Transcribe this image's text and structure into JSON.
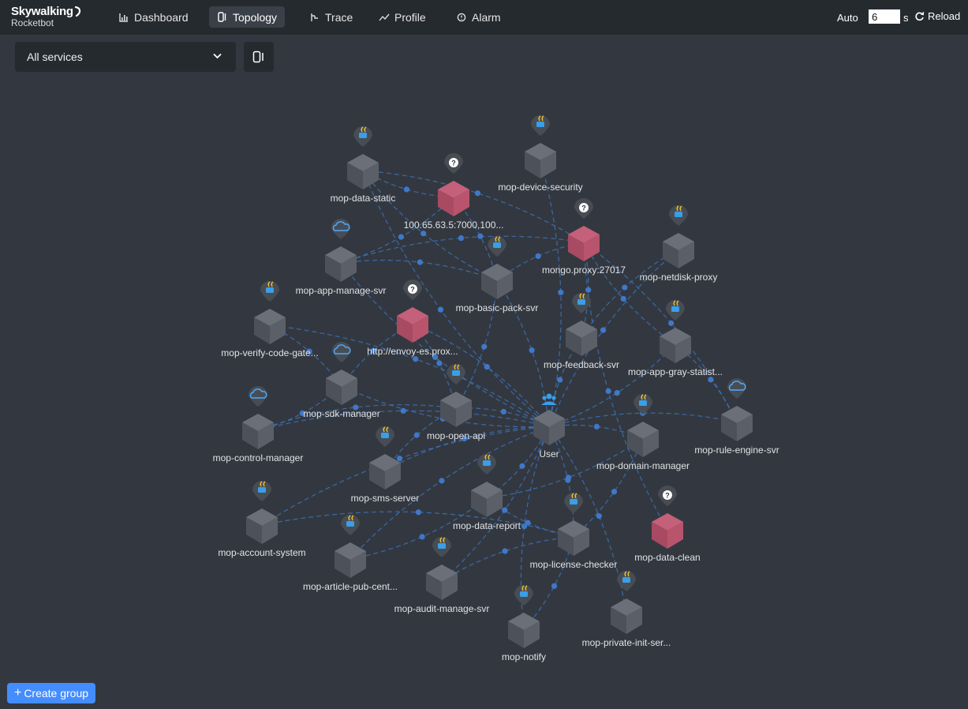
{
  "app": {
    "brand": "Skywalking",
    "subtitle": "Rocketbot"
  },
  "nav": {
    "items": [
      {
        "id": "dashboard",
        "label": "Dashboard",
        "icon": "bar-chart-icon",
        "active": false
      },
      {
        "id": "topology",
        "label": "Topology",
        "icon": "topology-icon",
        "active": true
      },
      {
        "id": "trace",
        "label": "Trace",
        "icon": "trace-icon",
        "active": false
      },
      {
        "id": "profile",
        "label": "Profile",
        "icon": "profile-icon",
        "active": false
      },
      {
        "id": "alarm",
        "label": "Alarm",
        "icon": "alarm-icon",
        "active": false
      }
    ],
    "auto_label": "Auto",
    "interval_value": "6",
    "interval_unit": "s",
    "reload_label": "Reload"
  },
  "toolbar": {
    "service_select": "All services"
  },
  "create_group_label": "Create group",
  "colors": {
    "background": "#333840",
    "navbar": "#252a2f",
    "edge": "#3d72b8",
    "node": "#575c65",
    "unknown_node": "#b8546c",
    "button": "#448dfe"
  },
  "topology": {
    "nodes": [
      {
        "id": "user",
        "label": "User",
        "type": "user"
      },
      {
        "id": "data-static",
        "label": "mop-data-static",
        "type": "java"
      },
      {
        "id": "es-ip",
        "label": "100.65.63.5:7000,100...",
        "type": "unknown"
      },
      {
        "id": "device-security",
        "label": "mop-device-security",
        "type": "java"
      },
      {
        "id": "mongo",
        "label": "mongo.proxy:27017",
        "type": "unknown"
      },
      {
        "id": "app-manage",
        "label": "mop-app-manage-svr",
        "type": "cloud"
      },
      {
        "id": "basic-pack",
        "label": "mop-basic-pack-svr",
        "type": "java"
      },
      {
        "id": "netdisk",
        "label": "mop-netdisk-proxy",
        "type": "java"
      },
      {
        "id": "verify-code",
        "label": "mop-verify-code-gate...",
        "type": "java"
      },
      {
        "id": "envoy",
        "label": "http://envoy-es.prox...",
        "type": "unknown"
      },
      {
        "id": "feedback",
        "label": "mop-feedback-svr",
        "type": "java"
      },
      {
        "id": "app-gray",
        "label": "mop-app-gray-statist...",
        "type": "java"
      },
      {
        "id": "sdk-manager",
        "label": "mop-sdk-manager",
        "type": "cloud"
      },
      {
        "id": "open-api",
        "label": "mop-open-api",
        "type": "java"
      },
      {
        "id": "rule-engine",
        "label": "mop-rule-engine-svr",
        "type": "cloud"
      },
      {
        "id": "control-manager",
        "label": "mop-control-manager",
        "type": "cloud"
      },
      {
        "id": "domain-manager",
        "label": "mop-domain-manager",
        "type": "java"
      },
      {
        "id": "sms-server",
        "label": "mop-sms-server",
        "type": "java"
      },
      {
        "id": "data-report",
        "label": "mop-data-report",
        "type": "java"
      },
      {
        "id": "data-clean",
        "label": "mop-data-clean",
        "type": "unknown"
      },
      {
        "id": "account-system",
        "label": "mop-account-system",
        "type": "java"
      },
      {
        "id": "license-checker",
        "label": "mop-license-checker",
        "type": "java"
      },
      {
        "id": "article-pub",
        "label": "mop-article-pub-cent...",
        "type": "java"
      },
      {
        "id": "audit-manage",
        "label": "mop-audit-manage-svr",
        "type": "java"
      },
      {
        "id": "notify",
        "label": "mop-notify",
        "type": "java"
      },
      {
        "id": "private-init",
        "label": "mop-private-init-ser...",
        "type": "java"
      }
    ],
    "edges": [
      [
        "user",
        "data-static"
      ],
      [
        "user",
        "device-security"
      ],
      [
        "user",
        "app-manage"
      ],
      [
        "user",
        "basic-pack"
      ],
      [
        "user",
        "netdisk"
      ],
      [
        "user",
        "verify-code"
      ],
      [
        "user",
        "feedback"
      ],
      [
        "user",
        "app-gray"
      ],
      [
        "user",
        "sdk-manager"
      ],
      [
        "user",
        "open-api"
      ],
      [
        "user",
        "rule-engine"
      ],
      [
        "user",
        "control-manager"
      ],
      [
        "user",
        "domain-manager"
      ],
      [
        "user",
        "sms-server"
      ],
      [
        "user",
        "data-report"
      ],
      [
        "user",
        "account-system"
      ],
      [
        "user",
        "license-checker"
      ],
      [
        "user",
        "article-pub"
      ],
      [
        "user",
        "audit-manage"
      ],
      [
        "user",
        "notify"
      ],
      [
        "user",
        "private-init"
      ],
      [
        "user",
        "envoy"
      ],
      [
        "data-static",
        "mongo"
      ],
      [
        "data-static",
        "es-ip"
      ],
      [
        "app-manage",
        "mongo"
      ],
      [
        "app-manage",
        "es-ip"
      ],
      [
        "basic-pack",
        "mongo"
      ],
      [
        "basic-pack",
        "es-ip"
      ],
      [
        "app-gray",
        "mongo"
      ],
      [
        "rule-engine",
        "mongo"
      ],
      [
        "data-clean",
        "mongo"
      ],
      [
        "feedback",
        "mongo"
      ],
      [
        "app-manage",
        "basic-pack"
      ],
      [
        "data-static",
        "basic-pack"
      ],
      [
        "sdk-manager",
        "envoy"
      ],
      [
        "open-api",
        "envoy"
      ],
      [
        "verify-code",
        "sdk-manager"
      ],
      [
        "control-manager",
        "sdk-manager"
      ],
      [
        "sms-server",
        "open-api"
      ],
      [
        "data-report",
        "license-checker"
      ],
      [
        "account-system",
        "license-checker"
      ],
      [
        "article-pub",
        "data-report"
      ],
      [
        "audit-manage",
        "license-checker"
      ],
      [
        "notify",
        "license-checker"
      ],
      [
        "domain-manager",
        "license-checker"
      ],
      [
        "netdisk",
        "feedback"
      ],
      [
        "app-gray",
        "rule-engine"
      ],
      [
        "open-api",
        "basic-pack"
      ],
      [
        "control-manager",
        "open-api"
      ],
      [
        "data-report",
        "domain-manager"
      ]
    ]
  }
}
